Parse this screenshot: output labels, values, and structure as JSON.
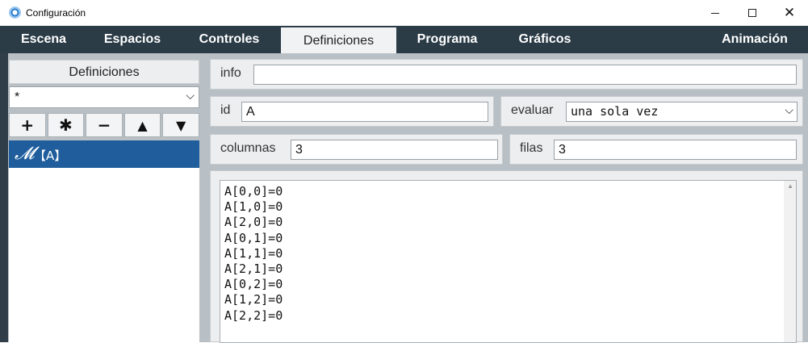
{
  "window": {
    "title": "Configuración"
  },
  "tabs": [
    {
      "label": "Escena",
      "active": false
    },
    {
      "label": "Espacios",
      "active": false
    },
    {
      "label": "Controles",
      "active": false
    },
    {
      "label": "Definiciones",
      "active": true
    },
    {
      "label": "Programa",
      "active": false
    },
    {
      "label": "Gráficos",
      "active": false
    },
    {
      "label": "Animación",
      "active": false
    }
  ],
  "left": {
    "title": "Definiciones",
    "filter": {
      "value": "*"
    },
    "toolbar": [
      "+",
      "✱",
      "−",
      "▲",
      "▼"
    ],
    "items": [
      {
        "icon": "𝓜",
        "label": "【A】",
        "selected": true
      }
    ]
  },
  "form": {
    "info": {
      "label": "info",
      "value": ""
    },
    "id": {
      "label": "id",
      "value": "A"
    },
    "evaluar": {
      "label": "evaluar",
      "value": "una sola vez"
    },
    "columnas": {
      "label": "columnas",
      "value": "3"
    },
    "filas": {
      "label": "filas",
      "value": "3"
    }
  },
  "code": {
    "lines": [
      "A[0,0]=0",
      "A[1,0]=0",
      "A[2,0]=0",
      "A[0,1]=0",
      "A[1,1]=0",
      "A[2,1]=0",
      "A[0,2]=0",
      "A[1,2]=0",
      "A[2,2]=0"
    ]
  },
  "colors": {
    "tabbar": "#2b3c47",
    "panel": "#b9c0c5",
    "selection": "#1f5d9c"
  }
}
